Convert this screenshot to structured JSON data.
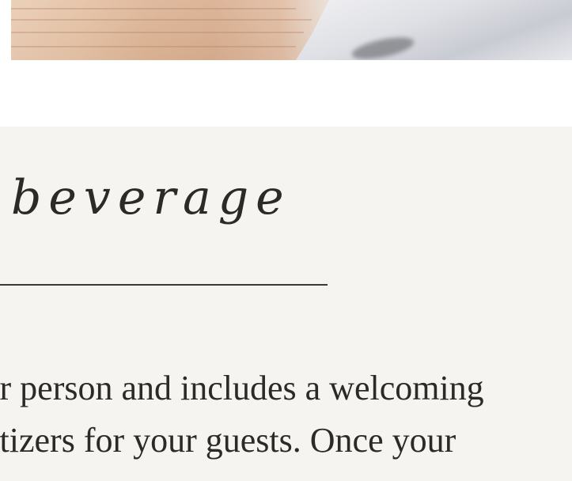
{
  "hero": {
    "image_alt": "decorative photo"
  },
  "section": {
    "heading": "beverage",
    "body_lines": [
      "er person and includes a welcoming",
      "etizers for your guests. Once your"
    ]
  },
  "colors": {
    "section_background": "#f5f4f0",
    "text": "#2b2a28"
  }
}
